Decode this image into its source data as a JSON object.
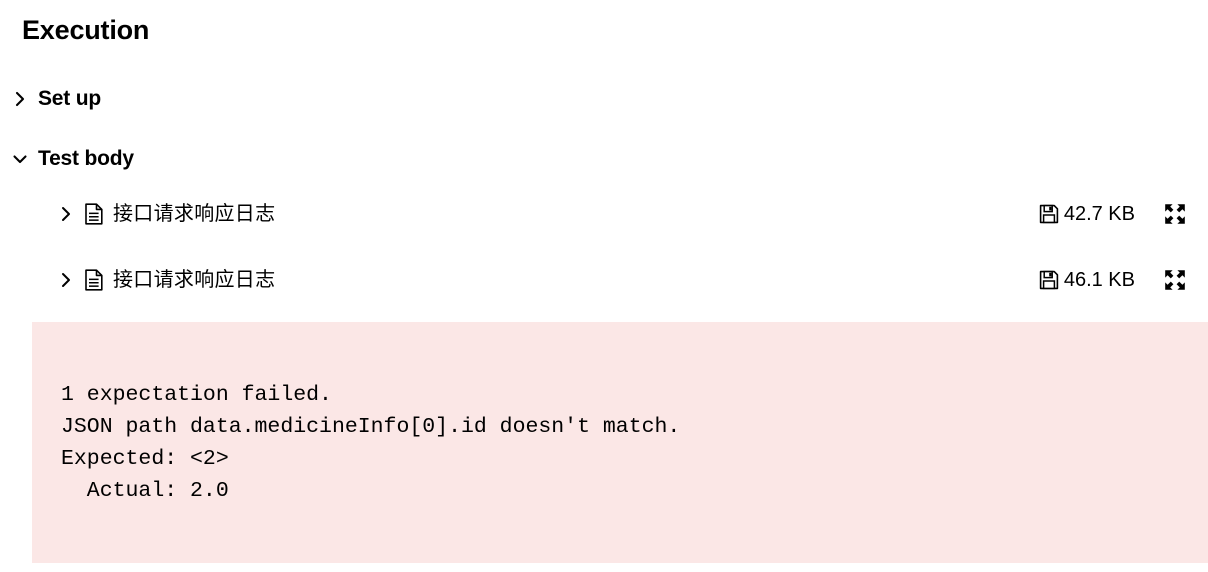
{
  "page": {
    "title": "Execution",
    "background_color": "#ffffff"
  },
  "sections": [
    {
      "label": "Set up",
      "expanded": false,
      "chevron_icon": "chevron-right-icon"
    },
    {
      "label": "Test body",
      "expanded": true,
      "chevron_icon": "chevron-down-icon"
    }
  ],
  "attachments": [
    {
      "name": "接口请求响应日志",
      "size": "42.7 KB",
      "expanded": false,
      "chevron_icon": "chevron-right-icon",
      "file_icon": "document-icon",
      "size_icon": "save-floppy-icon",
      "expand_icon": "fullscreen-expand-icon"
    },
    {
      "name": "接口请求响应日志",
      "size": "46.1 KB",
      "expanded": false,
      "chevron_icon": "chevron-right-icon",
      "file_icon": "document-icon",
      "size_icon": "save-floppy-icon",
      "expand_icon": "fullscreen-expand-icon"
    }
  ],
  "error": {
    "background_color": "#fbe7e6",
    "message": "1 expectation failed.\nJSON path data.medicineInfo[0].id doesn't match.\nExpected: <2>\n  Actual: 2.0",
    "lines": [
      "1 expectation failed.",
      "JSON path data.medicineInfo[0].id doesn't match.",
      "Expected: <2>",
      "  Actual: 2.0"
    ]
  }
}
